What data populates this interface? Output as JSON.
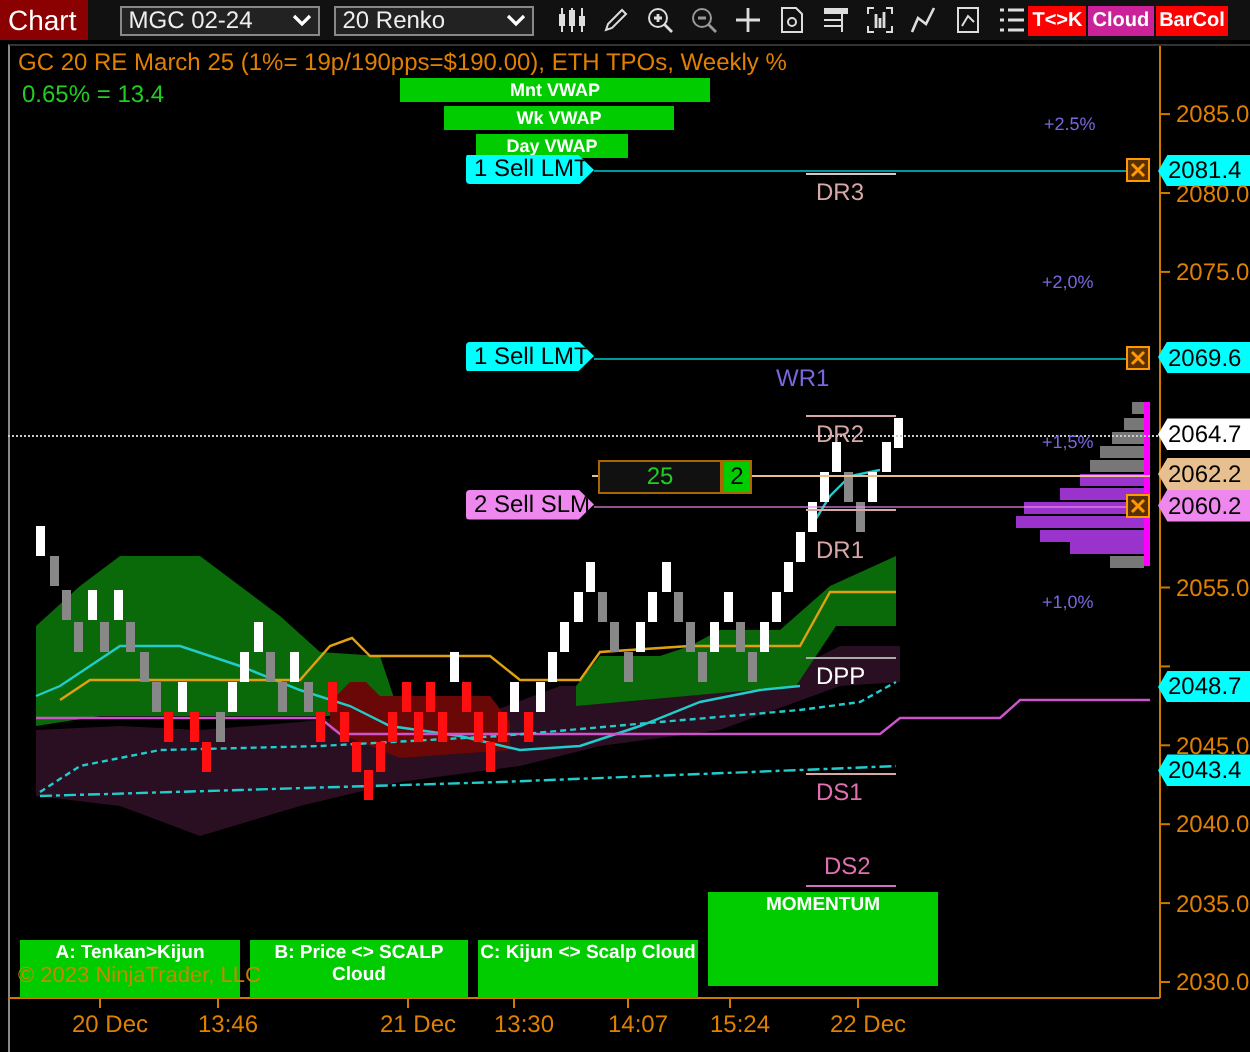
{
  "toolbar": {
    "title": "Chart",
    "instrument": "MGC 02-24",
    "interval": "20 Renko",
    "buttons": [
      {
        "label": "T<>K",
        "color": "#ff0000"
      },
      {
        "label": "Cloud",
        "color": "#cc2299"
      },
      {
        "label": "BarCol",
        "color": "#ff0000"
      }
    ]
  },
  "chart": {
    "header": "GC 20 RE March 25 (1%= 19p/190pps=$190.00), ETH TPOs, Weekly %",
    "subheader": "0.65% = 13.4",
    "vwap_labels": [
      "Mnt VWAP",
      "Wk VWAP",
      "Day VWAP"
    ],
    "percent_labels": [
      "+2.5%",
      "+2,0%",
      "+1,5%",
      "+1,0%"
    ],
    "pivots": [
      "DR3",
      "WR1",
      "DR2",
      "DR1",
      "DPP",
      "DS1",
      "DS2"
    ],
    "orders": [
      {
        "label": "1 Sell LMT",
        "price": "2081.4",
        "color": "#00ffff"
      },
      {
        "label": "1 Sell LMT",
        "price": "2069.6",
        "color": "#00ffff"
      },
      {
        "label": "2 Sell SLM",
        "price": "2060.2",
        "color": "#ee88ee"
      }
    ],
    "position": {
      "quantity": "25",
      "count": "2"
    },
    "price_axis": {
      "ticks": [
        "2085.0",
        "2080.0",
        "2075.0",
        "2055.0",
        "2045.0",
        "2040.0",
        "2035.0",
        "2030.0"
      ],
      "markers": [
        {
          "price": "2064.7",
          "color": "#ffffff"
        },
        {
          "price": "2062.2",
          "color": "#e8c090"
        },
        {
          "price": "2048.7",
          "color": "#00ffff"
        },
        {
          "price": "2043.4",
          "color": "#00ffff"
        }
      ]
    },
    "signals": [
      "A: Tenkan>Kijun",
      "B: Price <> SCALP Cloud",
      "C: Kijun <> Scalp Cloud",
      "MOMENTUM"
    ],
    "copyright": "© 2023 NinjaTrader, LLC",
    "time_axis": [
      "20 Dec",
      "13:46",
      "21 Dec",
      "13:30",
      "14:07",
      "15:24",
      "22 Dec"
    ]
  }
}
